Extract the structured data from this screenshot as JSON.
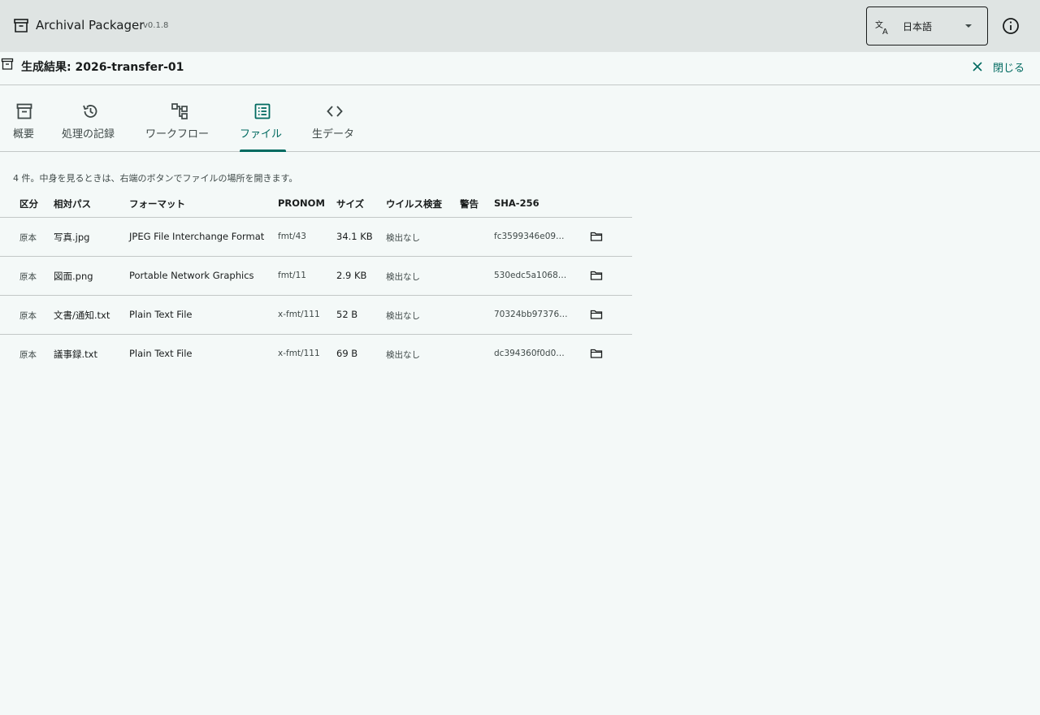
{
  "app": {
    "title": "Archival Packager",
    "version": "v0.1.8",
    "language": "日本語"
  },
  "result": {
    "title": "生成結果: 2026-transfer-01",
    "close_label": "閉じる"
  },
  "tabs": [
    {
      "label": "概要",
      "icon": "archive-icon"
    },
    {
      "label": "処理の記録",
      "icon": "history-icon"
    },
    {
      "label": "ワークフロー",
      "icon": "workflow-icon"
    },
    {
      "label": "ファイル",
      "icon": "list-icon",
      "active": true
    },
    {
      "label": "生データ",
      "icon": "code-icon"
    }
  ],
  "files": {
    "summary": "4 件。中身を見るときは、右端のボタンでファイルの場所を開きます。",
    "columns": [
      "区分",
      "相対パス",
      "フォーマット",
      "PRONOM",
      "サイズ",
      "ウイルス検査",
      "警告",
      "SHA-256"
    ],
    "rows": [
      {
        "type": "原本",
        "path": "写真.jpg",
        "format": "JPEG File Interchange Format",
        "pronom": "fmt/43",
        "size": "34.1 KB",
        "virus": "検出なし",
        "warning": "",
        "sha": "fc3599346e09…"
      },
      {
        "type": "原本",
        "path": "図面.png",
        "format": "Portable Network Graphics",
        "pronom": "fmt/11",
        "size": "2.9 KB",
        "virus": "検出なし",
        "warning": "",
        "sha": "530edc5a1068…"
      },
      {
        "type": "原本",
        "path": "文書/通知.txt",
        "format": "Plain Text File",
        "pronom": "x-fmt/111",
        "size": "52 B",
        "virus": "検出なし",
        "warning": "",
        "sha": "70324bb97376…"
      },
      {
        "type": "原本",
        "path": "議事録.txt",
        "format": "Plain Text File",
        "pronom": "x-fmt/111",
        "size": "69 B",
        "virus": "検出なし",
        "warning": "",
        "sha": "dc394360f0d0…"
      }
    ]
  },
  "colors": {
    "accent": "#006a60",
    "appbar": "#dfe4e3",
    "background": "#f4f9f8",
    "divider": "#c3c8c7"
  }
}
